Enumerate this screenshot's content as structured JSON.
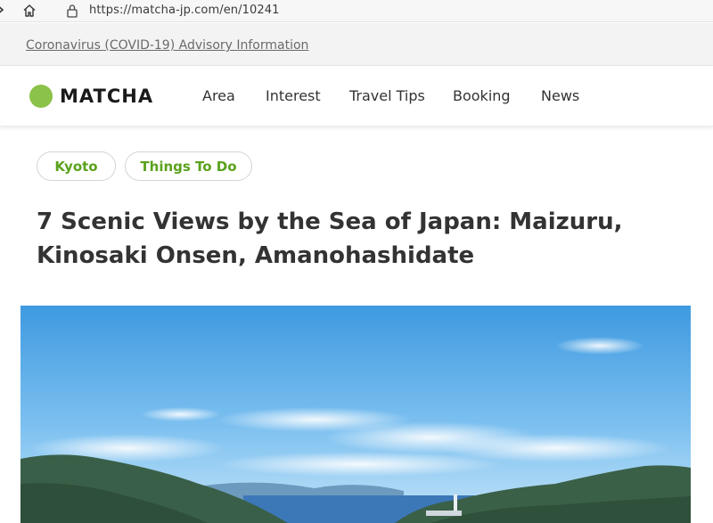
{
  "browser": {
    "url": "https://matcha-jp.com/en/10241"
  },
  "advisory": {
    "link_text": "Coronavirus (COVID-19) Advisory Information"
  },
  "header": {
    "logo_text": "MATCHA",
    "logo_color": "#8bc34a",
    "nav": [
      {
        "label": "Area"
      },
      {
        "label": "Interest"
      },
      {
        "label": "Travel Tips"
      },
      {
        "label": "Booking"
      },
      {
        "label": "News"
      }
    ]
  },
  "tags": [
    {
      "label": "Kyoto"
    },
    {
      "label": "Things To Do"
    }
  ],
  "article": {
    "title": "7 Scenic Views by the Sea of Japan: Maizuru, Kinosaki Onsen, Amanohashidate"
  },
  "colors": {
    "tag_text": "#5aa21c",
    "title_text": "#333333",
    "advisory_bg": "#f3f3f3"
  }
}
